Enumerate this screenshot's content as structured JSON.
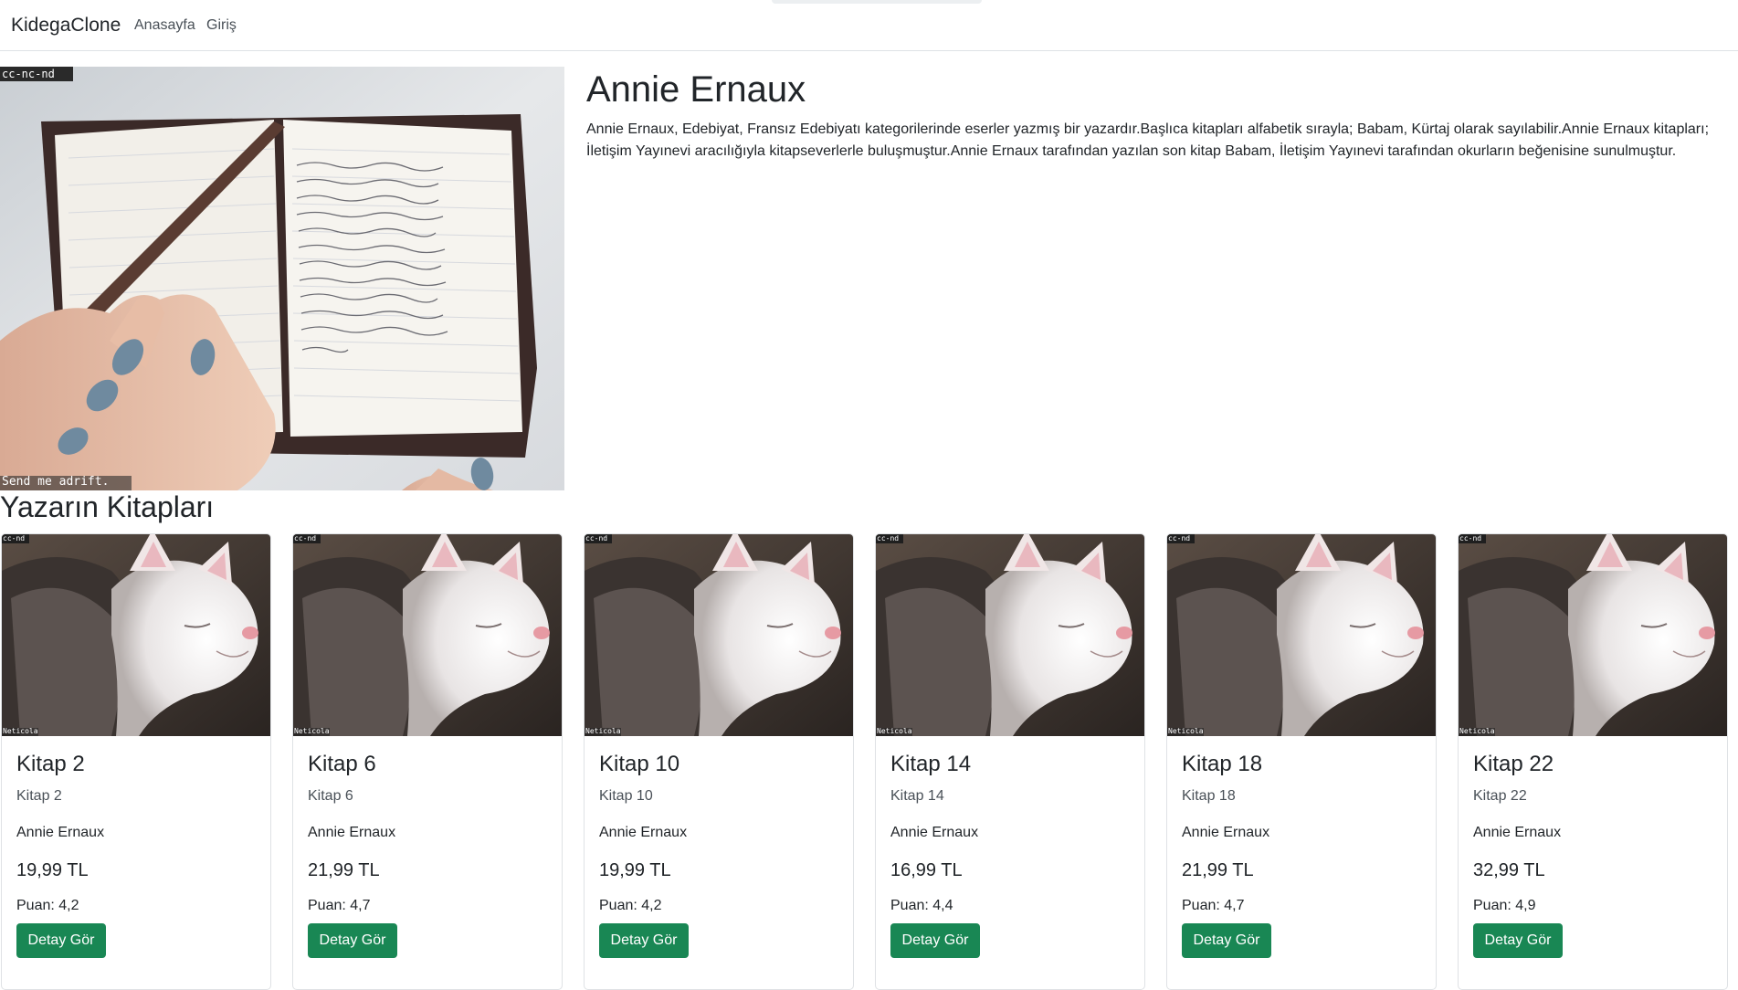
{
  "navbar": {
    "brand": "KidegaClone",
    "links": [
      "Anasayfa",
      "Giriş"
    ]
  },
  "author": {
    "name": "Annie Ernaux",
    "bio": "Annie Ernaux, Edebiyat, Fransız Edebiyatı kategorilerinde eserler yazmış bir yazardır.Başlıca kitapları alfabetik sırayla; Babam, Kürtaj olarak sayılabilir.Annie Ernaux kitapları; İletişim Yayınevi aracılığıyla kitapseverlerle buluşmuştur.Annie Ernaux tarafından yazılan son kitap Babam, İletişim Yayınevi tarafından okurların beğenisine sunulmuştur.",
    "image": {
      "watermark_top": "cc-nc-nd",
      "watermark_bottom": "Send me adrift."
    }
  },
  "books_section": {
    "title": "Yazarın Kitapları",
    "image_watermark_top": "cc-nd",
    "image_watermark_bottom": "Neticola",
    "button_label": "Detay Gör",
    "books": [
      {
        "title": "Kitap 2",
        "subtitle": "Kitap 2",
        "author": "Annie Ernaux",
        "price": "19,99 TL",
        "rating": "Puan: 4,2"
      },
      {
        "title": "Kitap 6",
        "subtitle": "Kitap 6",
        "author": "Annie Ernaux",
        "price": "21,99 TL",
        "rating": "Puan: 4,7"
      },
      {
        "title": "Kitap 10",
        "subtitle": "Kitap 10",
        "author": "Annie Ernaux",
        "price": "19,99 TL",
        "rating": "Puan: 4,2"
      },
      {
        "title": "Kitap 14",
        "subtitle": "Kitap 14",
        "author": "Annie Ernaux",
        "price": "16,99 TL",
        "rating": "Puan: 4,4"
      },
      {
        "title": "Kitap 18",
        "subtitle": "Kitap 18",
        "author": "Annie Ernaux",
        "price": "21,99 TL",
        "rating": "Puan: 4,7"
      },
      {
        "title": "Kitap 22",
        "subtitle": "Kitap 22",
        "author": "Annie Ernaux",
        "price": "32,99 TL",
        "rating": "Puan: 4,9"
      }
    ]
  },
  "colors": {
    "button": "#198754",
    "border": "#dee2e6"
  }
}
